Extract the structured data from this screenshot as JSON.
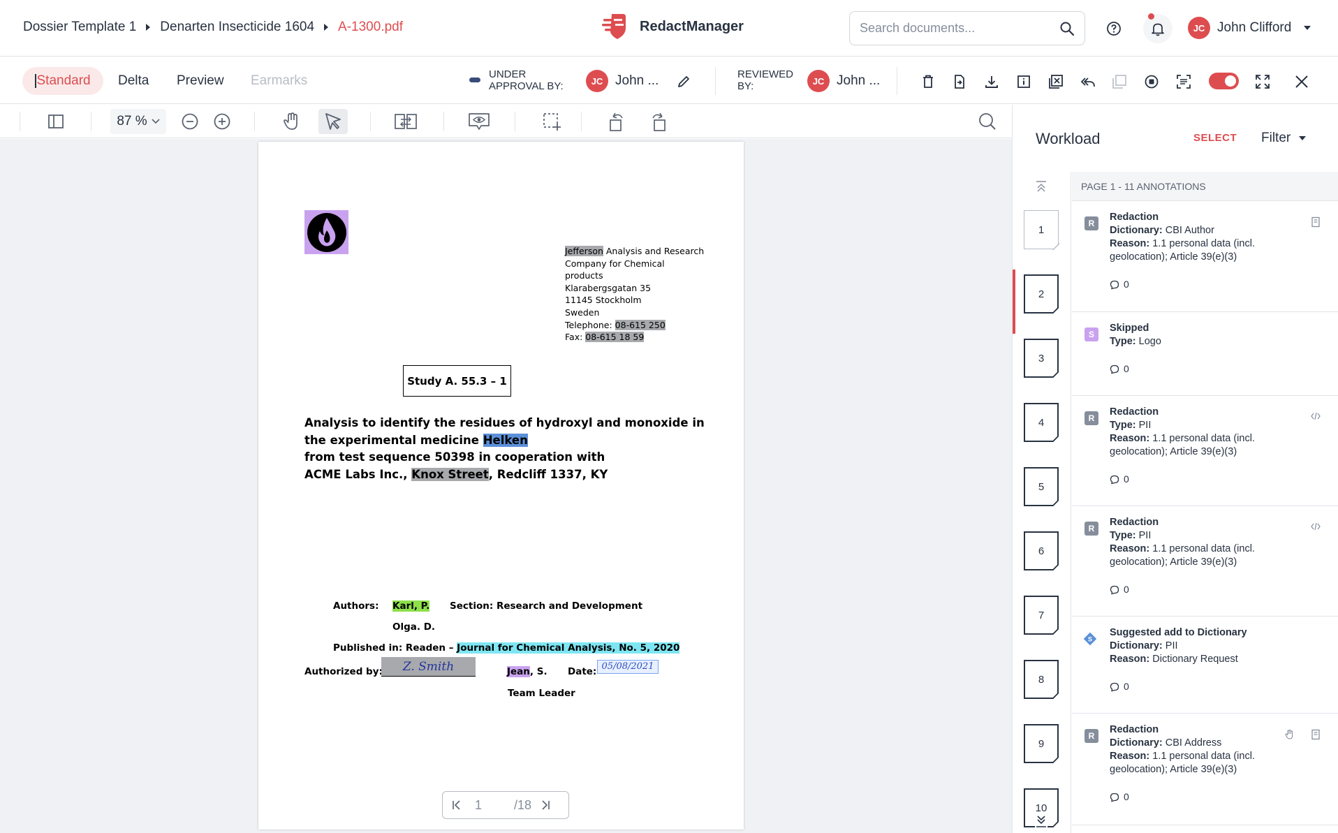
{
  "breadcrumb": {
    "items": [
      "Dossier Template 1",
      "Denarten Insecticide 1604"
    ],
    "current": "A-1300.pdf"
  },
  "brand": {
    "name": "RedactManager",
    "color": "#dd4d50"
  },
  "search": {
    "placeholder": "Search documents..."
  },
  "header": {
    "help_icon": "help-icon",
    "bell_icon": "bell-icon",
    "user_initials": "JC",
    "user_name": "John Clifford"
  },
  "view_tabs": [
    {
      "label": "Standard",
      "state": "active"
    },
    {
      "label": "Delta",
      "state": "normal"
    },
    {
      "label": "Preview",
      "state": "normal"
    },
    {
      "label": "Earmarks",
      "state": "disabled"
    }
  ],
  "approval": {
    "label": "UNDER APPROVAL BY:",
    "initials": "JC",
    "name": "John ..."
  },
  "review": {
    "label": "REVIEWED BY:",
    "initials": "JC",
    "name": "John ..."
  },
  "viewer_tools": {
    "zoom": "87 %"
  },
  "document": {
    "address_lines": [
      {
        "pre": "",
        "hl": "Jefferson",
        "post": " Analysis and Research"
      },
      {
        "pre": "Company for Chemical",
        "hl": "",
        "post": ""
      },
      {
        "pre": "products",
        "hl": "",
        "post": ""
      },
      {
        "pre": "Klarabergsgatan 35",
        "hl": "",
        "post": ""
      },
      {
        "pre": "11145 Stockholm",
        "hl": "",
        "post": ""
      },
      {
        "pre": "Sweden",
        "hl": "",
        "post": ""
      },
      {
        "pre": "Telephone: ",
        "hl": "08-615 250",
        "post": ""
      },
      {
        "pre": "Fax: ",
        "hl": "08-615 18 59",
        "post": ""
      }
    ],
    "study": "Study A. 55.3 – 1",
    "title": {
      "line1": "Analysis to identify the residues of hydroxyl and monoxide in",
      "line2_pre": "the experimental medicine ",
      "line2_hl": "Helken",
      "line3": "from test sequence 50398 in cooperation with",
      "line4_pre": "ACME Labs Inc., ",
      "line4_hl": "Knox Street",
      "line4_post": ", Redcliff 1337, KY"
    },
    "authors_label": "Authors:",
    "author1": "Karl, P.",
    "section": "Section: Research and Development",
    "author2": "Olga. D.",
    "published_pre": "Published in: Readen – ",
    "published_hl": "Journal for Chemical Analysis, No. 5, 2020",
    "authorized_label": "Authorized by:",
    "signature": "Z. Smith",
    "auth_name_hl": "Jean",
    "auth_name_post": ", S.",
    "date_label": "Date:",
    "date_value": "05/08/2021",
    "role": "Team Leader"
  },
  "pagination": {
    "current": "1",
    "total": "/18"
  },
  "workload": {
    "title": "Workload",
    "select": "SELECT",
    "filter": "Filter",
    "page_header": "PAGE 1 - 11 ANNOTATIONS",
    "thumbnails": [
      "1",
      "2",
      "3",
      "4",
      "5",
      "6",
      "7",
      "8",
      "9",
      "10"
    ],
    "annotations": [
      {
        "badge": "R",
        "title": "Redaction",
        "k1": "Dictionary:",
        "v1": "CBI Author",
        "k2": "Reason:",
        "v2": "1.1 personal data (incl. geolocation); Article 39(e)(3)",
        "comments": "0"
      },
      {
        "badge": "S",
        "title": "Skipped",
        "k1": "Type:",
        "v1": "Logo",
        "k2": "",
        "v2": "",
        "comments": "0"
      },
      {
        "badge": "R",
        "title": "Redaction",
        "k1": "Type:",
        "v1": "PII",
        "k2": "Reason:",
        "v2": "1.1 personal data (incl. geolocation); Article 39(e)(3)",
        "comments": "0"
      },
      {
        "badge": "R",
        "title": "Redaction",
        "k1": "Type:",
        "v1": "PII",
        "k2": "Reason:",
        "v2": "1.1 personal data (incl. geolocation); Article 39(e)(3)",
        "comments": "0"
      },
      {
        "badge": "S",
        "title": "Suggested add to Dictionary",
        "k1": "Dictionary:",
        "v1": "PII",
        "k2": "Reason:",
        "v2": "Dictionary Request",
        "comments": "0"
      },
      {
        "badge": "R",
        "title": "Redaction",
        "k1": "Dictionary:",
        "v1": "CBI Address",
        "k2": "Reason:",
        "v2": "1.1 personal data (incl. geolocation); Article 39(e)(3)",
        "comments": "0"
      }
    ]
  }
}
